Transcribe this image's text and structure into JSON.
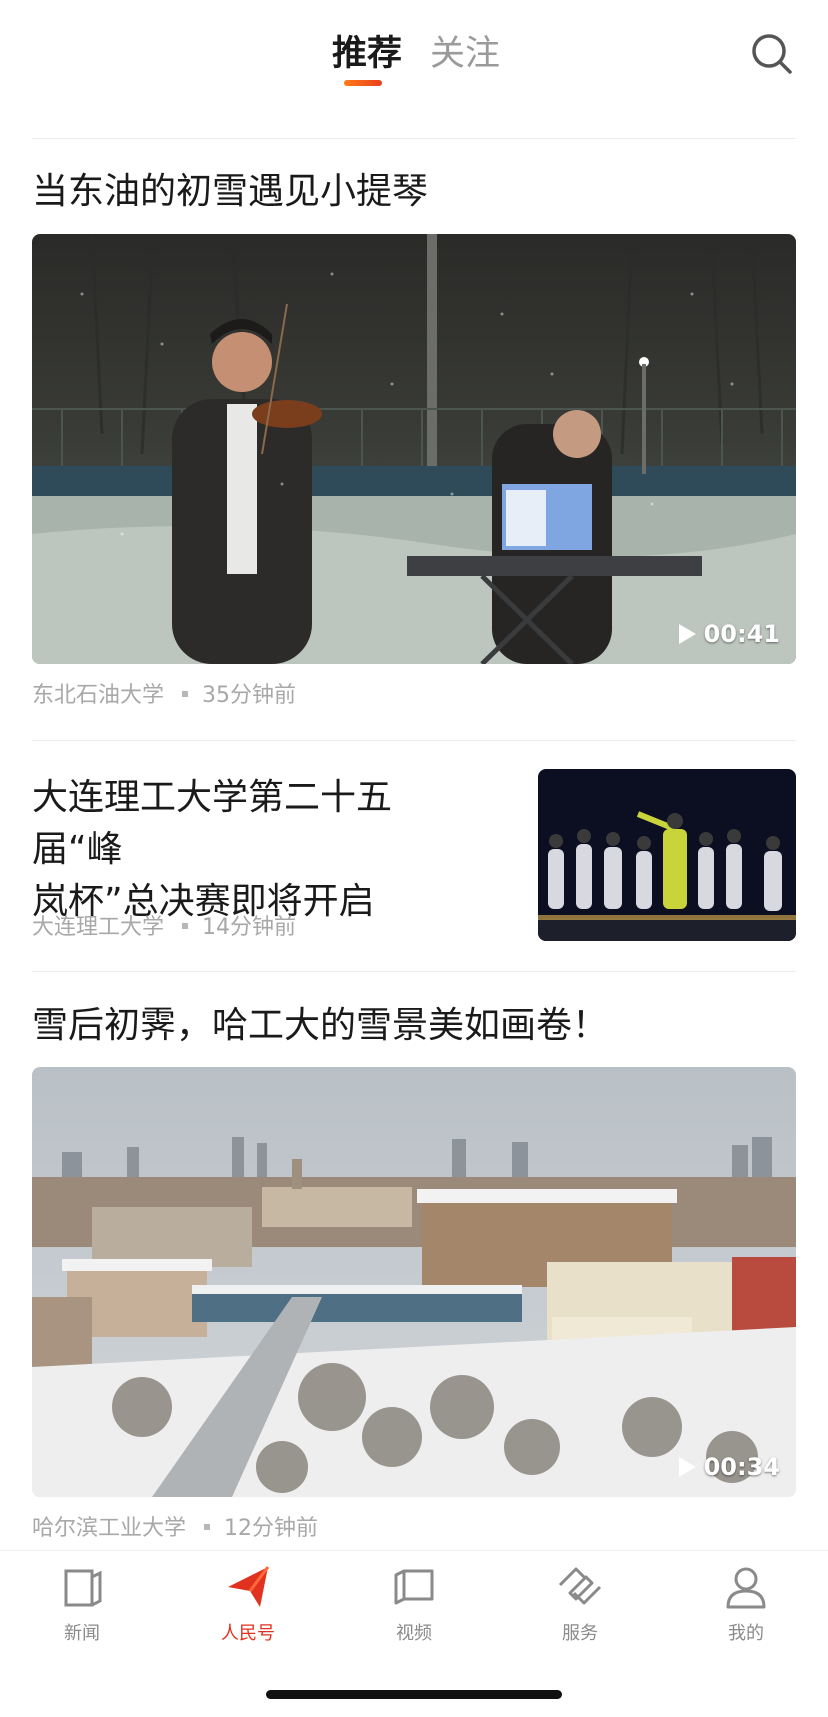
{
  "header": {
    "tabs": [
      "推荐",
      "关注"
    ],
    "active_tab": "推荐"
  },
  "feed": [
    {
      "title": "当东油的初雪遇见小提琴",
      "source": "东北石油大学",
      "time": "35分钟前",
      "media": "video",
      "duration": "00:41"
    },
    {
      "title_line1": "大连理工大学第二十五届“峰",
      "title_line2": "岚杯”总决赛即将开启",
      "source": "大连理工大学",
      "time": "14分钟前",
      "media": "thumbnail"
    },
    {
      "title": "雪后初霁，哈工大的雪景美如画卷！",
      "source": "哈尔滨工业大学",
      "time": "12分钟前",
      "media": "video",
      "duration": "00:34"
    }
  ],
  "bottom_nav": [
    {
      "label": "新闻",
      "icon": "news-icon"
    },
    {
      "label": "人民号",
      "icon": "peoples-account-icon",
      "active": true
    },
    {
      "label": "视频",
      "icon": "video-icon"
    },
    {
      "label": "服务",
      "icon": "service-icon"
    },
    {
      "label": "我的",
      "icon": "profile-icon"
    }
  ],
  "colors": {
    "accent": "#e0321e",
    "tab_underline": "#ff7a1a",
    "meta_text": "#a8a8a8"
  }
}
